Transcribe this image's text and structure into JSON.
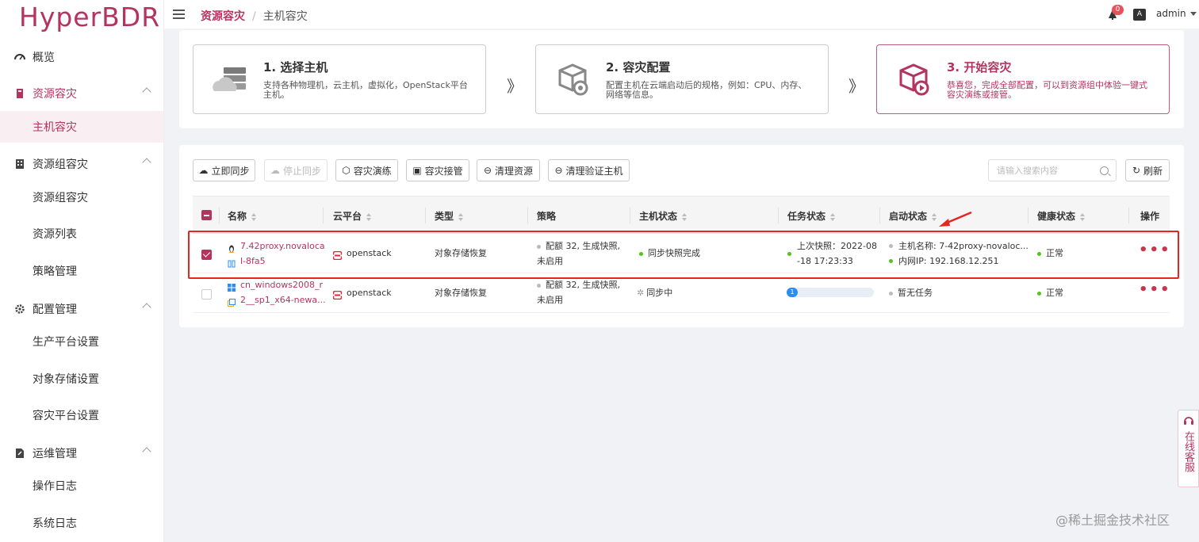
{
  "app": {
    "logo": "HyperBDR"
  },
  "sidebar": {
    "groups": [
      {
        "label": "概览",
        "icon": "dashboard-icon"
      },
      {
        "label": "资源容灾",
        "icon": "shield-icon",
        "items": [
          "主机容灾"
        ]
      },
      {
        "label": "资源组容灾",
        "icon": "building-icon",
        "items": [
          "资源组容灾",
          "资源列表",
          "策略管理"
        ]
      },
      {
        "label": "配置管理",
        "icon": "gear-icon",
        "items": [
          "生产平台设置",
          "对象存储设置",
          "容灾平台设置"
        ]
      },
      {
        "label": "运维管理",
        "icon": "tools-icon",
        "items": [
          "操作日志",
          "系统日志"
        ]
      }
    ]
  },
  "header": {
    "breadcrumb": [
      "资源容灾",
      "主机容灾"
    ],
    "separator": "/",
    "notification_count": "0",
    "lang_label": "A",
    "user": "admin"
  },
  "steps": [
    {
      "title": "1. 选择主机",
      "desc_line1": "支持各种物理机，云主机，虚拟化，OpenStack平台",
      "desc_line2": "主机。"
    },
    {
      "title": "2. 容灾配置",
      "desc_line1": "配置主机在云端启动后的规格，例如：CPU、内存、",
      "desc_line2": "网络等信息。"
    },
    {
      "title": "3. 开始容灾",
      "desc_line1": "恭喜您，完成全部配置，可以到资源组中体验一键式",
      "desc_line2": "容灾演练或接管。"
    }
  ],
  "step_separator": "》",
  "toolbar": {
    "buttons": [
      "立即同步",
      "停止同步",
      "容灾演练",
      "容灾接管",
      "清理资源",
      "清理验证主机"
    ],
    "search_placeholder": "请输入搜索内容",
    "refresh": "刷新"
  },
  "table": {
    "columns": [
      "名称",
      "云平台",
      "类型",
      "策略",
      "主机状态",
      "任务状态",
      "启动状态",
      "健康状态",
      "操作"
    ],
    "rows": [
      {
        "checked": true,
        "name_line1": "7.42proxy.novaloca",
        "name_line2": "l-8fa5",
        "platform": "openstack",
        "type": "对象存储恢复",
        "policy_line1": "配额 32, 生成快照,",
        "policy_line2": "未启用",
        "host_status": "同步快照完成",
        "task_line1": "上次快照：2022-08",
        "task_line2": "-18 17:23:33",
        "boot_line1": "主机名称: 7-42proxy-novaloc...",
        "boot_line2": "内网IP: 192.168.12.251",
        "health": "正常",
        "ops": "•••"
      },
      {
        "checked": false,
        "name_line1": "cn_windows2008_r",
        "name_line2": "2__sp1_x64-newa...",
        "platform": "openstack",
        "type": "对象存储恢复",
        "policy_line1": "配额 32, 生成快照,",
        "policy_line2": "未启用",
        "host_status": "同步中",
        "task_progress": 0.12,
        "task_progress_label": "1",
        "boot_line1": "暂无任务",
        "health": "正常",
        "ops": "•••"
      }
    ]
  },
  "floating_service": {
    "label": "在线客服"
  },
  "watermark": "@稀土掘金技术社区",
  "colors": {
    "brand": "#b5345f",
    "success": "#52c41a",
    "highlight": "#e6261f",
    "progress": "#2d8cf0"
  }
}
